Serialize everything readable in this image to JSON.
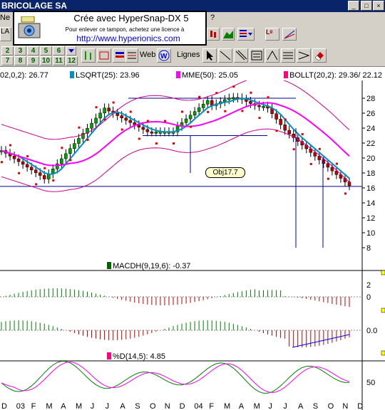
{
  "window": {
    "title": "BRICOLAGE SA"
  },
  "menu": {
    "items": [
      "Ne",
      "?"
    ]
  },
  "toolbar": {
    "number_buttons": [
      "2",
      "3",
      "4",
      "5",
      "6",
      "7",
      "8",
      "9",
      "10",
      "11",
      "12"
    ],
    "web_label": "Web",
    "lines_label": "Lignes"
  },
  "stamp": {
    "line1": "Crée avec HyperSnap-DX 5",
    "line2": "Pour enlever ce tampon, achetez une licence à",
    "line3": "http://www.hyperionics.com"
  },
  "legend": {
    "item0": "02,0,2): 26.77",
    "item1": "LSQRT(25): 23.96",
    "item2": "MME(50): 25.05",
    "item3": "BOLLT(20,2): 29.36/ 22.12"
  },
  "price_axis": [
    "28",
    "26",
    "24",
    "22",
    "20",
    "18",
    "16",
    "14",
    "12",
    "10",
    "8"
  ],
  "target_label": "Obj17.7",
  "macd": {
    "label": "MACDH(9,19,6): -0.37",
    "ticks": [
      "2",
      "0"
    ],
    "ticks2": [
      "0.0"
    ]
  },
  "stoch": {
    "label": "%D(14,5): 4.85",
    "ticks": [
      "50"
    ]
  },
  "x_axis": [
    "D",
    "03",
    "F",
    "M",
    "A",
    "M",
    "J",
    "J",
    "A",
    "S",
    "O",
    "N",
    "D",
    "04",
    "F",
    "M",
    "A",
    "M",
    "J",
    "J",
    "A",
    "S",
    "O",
    "N",
    "D"
  ],
  "colors": {
    "title_bg": "#0a246a",
    "price_up": "#00a000",
    "price_down": "#c00000",
    "lsqrt": "#0090c0",
    "mme": "#ff00ff",
    "bollinger": "#d00090",
    "parabolic": "#e00000"
  }
}
